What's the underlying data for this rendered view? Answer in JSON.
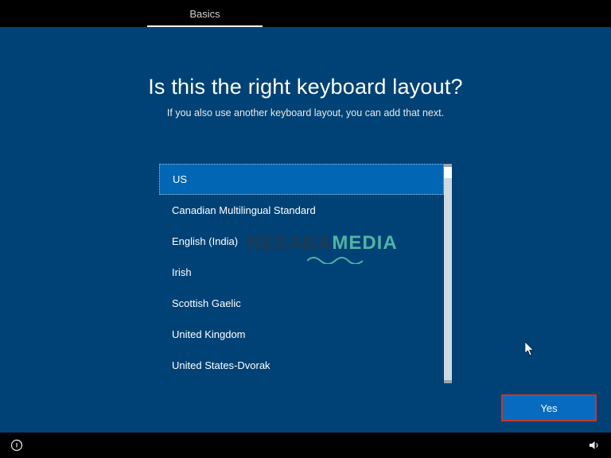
{
  "top_tab": {
    "label": "Basics"
  },
  "heading": {
    "title": "Is this the right keyboard layout?",
    "subtitle": "If you also use another keyboard layout, you can add that next."
  },
  "layouts": {
    "items": [
      {
        "label": "US",
        "selected": true
      },
      {
        "label": "Canadian Multilingual Standard",
        "selected": false
      },
      {
        "label": "English (India)",
        "selected": false
      },
      {
        "label": "Irish",
        "selected": false
      },
      {
        "label": "Scottish Gaelic",
        "selected": false
      },
      {
        "label": "United Kingdom",
        "selected": false
      },
      {
        "label": "United States-Dvorak",
        "selected": false
      }
    ]
  },
  "watermark": {
    "part1": "NESABA",
    "part2": "MEDIA"
  },
  "confirm_button": {
    "label": "Yes"
  },
  "bottom_bar": {
    "ease_icon": "ease-of-access",
    "volume_icon": "volume"
  }
}
